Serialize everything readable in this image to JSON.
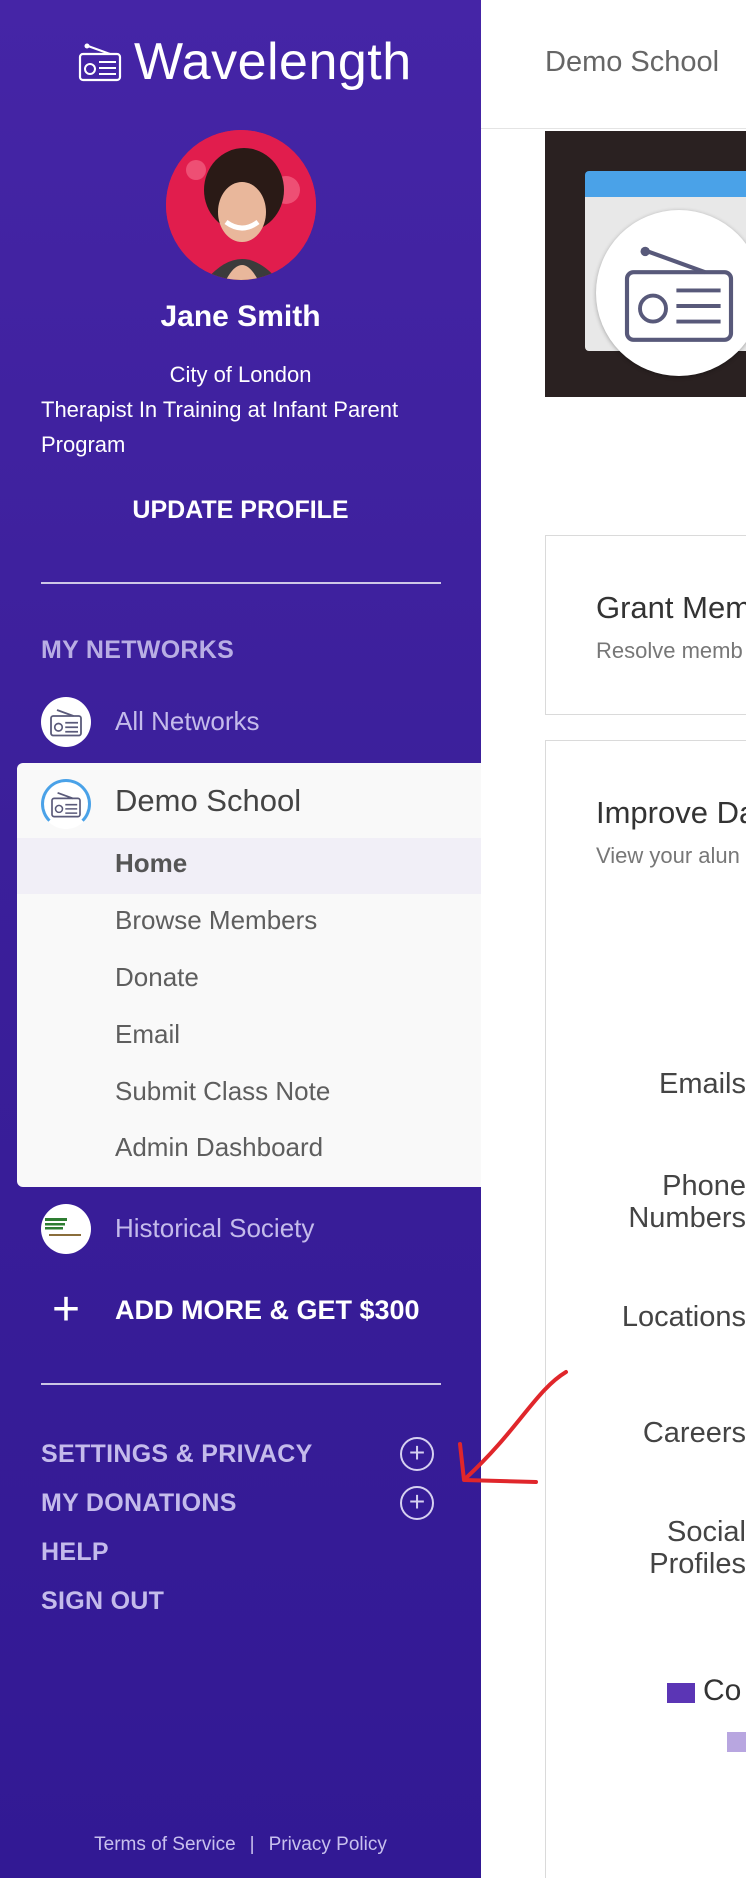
{
  "app": {
    "name": "Wavelength"
  },
  "profile": {
    "name": "Jane Smith",
    "location": "City of London",
    "title": "Therapist In Training at Infant Parent Program",
    "update_label": "UPDATE PROFILE"
  },
  "networks": {
    "section_title": "MY NETWORKS",
    "all_networks": "All Networks",
    "active_network": {
      "name": "Demo School",
      "items": [
        {
          "label": "Home",
          "active": true
        },
        {
          "label": "Browse Members"
        },
        {
          "label": "Donate"
        },
        {
          "label": "Email"
        },
        {
          "label": "Submit Class Note"
        },
        {
          "label": "Admin Dashboard"
        }
      ]
    },
    "other_network": "Historical Society",
    "add_more_label": "ADD MORE & GET $300"
  },
  "menu": {
    "settings": "SETTINGS & PRIVACY",
    "donations": "MY DONATIONS",
    "help": "HELP",
    "sign_out": "SIGN OUT"
  },
  "footer": {
    "terms": "Terms of Service",
    "separator": "|",
    "privacy": "Privacy Policy"
  },
  "main": {
    "header_title": "Demo School",
    "cards": [
      {
        "title": "Grant Mem",
        "subtitle": "Resolve memb"
      },
      {
        "title": "Improve Da",
        "subtitle": "View your alun"
      }
    ],
    "stats": [
      "Emails",
      "Phone Numbers",
      "Locations",
      "Careers",
      "Social Profiles"
    ],
    "legend": [
      {
        "label": "Co",
        "color": "#5b35b5"
      },
      {
        "label": "",
        "color": "#b8a6e0"
      }
    ]
  },
  "colors": {
    "sidebar": "#3b1f9a",
    "accent": "#4aa2e8",
    "annotation": "#e0262b"
  }
}
